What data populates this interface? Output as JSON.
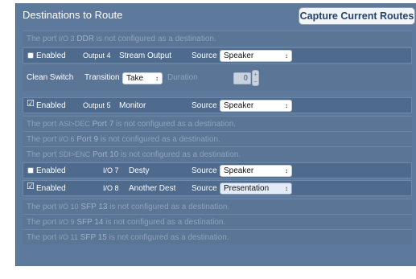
{
  "header": {
    "title": "Destinations to Route",
    "capture_label": "Capture Current Routes"
  },
  "rows": [
    {
      "type": "empty",
      "pre": "The port",
      "port": "I/O 3",
      "name": "DDR",
      "post": "is not configured as a destination."
    },
    {
      "type": "dest",
      "enabled_checked": false,
      "enabled_label": "Enabled",
      "port": "Output 4",
      "name": "Stream Output",
      "source_label": "Source",
      "source_value": "Speaker"
    },
    {
      "type": "clean",
      "clean_label": "Clean Switch",
      "transition_label": "Transition",
      "transition_value": "Take",
      "duration_label": "Duration",
      "duration_value": "0"
    },
    {
      "type": "dest",
      "enabled_checked": true,
      "enabled_label": "Enabled",
      "port": "Output 5",
      "name": "Monitor",
      "source_label": "Source",
      "source_value": "Speaker"
    },
    {
      "type": "empty",
      "pre": "The port",
      "port": "ASI>DEC",
      "name": "Port 7",
      "post": "is not configured as a destination."
    },
    {
      "type": "empty",
      "pre": "The port",
      "port": "I/O 6",
      "name": "Port 9",
      "post": "is not configured as a destination."
    },
    {
      "type": "empty",
      "pre": "The port",
      "port": "SDI>ENC",
      "name": "Port 10",
      "post": "is not configured as a destination."
    },
    {
      "type": "dest",
      "enabled_checked": false,
      "enabled_label": "Enabled",
      "port": "I/O 7",
      "name": "Desty",
      "source_label": "Source",
      "source_value": "Speaker"
    },
    {
      "type": "dest",
      "enabled_checked": true,
      "enabled_label": "Enabled",
      "port": "I/O 8",
      "name": "Another Dest",
      "source_label": "Source",
      "source_value": "Presentation"
    },
    {
      "type": "empty",
      "pre": "The port",
      "port": "I/O 10",
      "name": "SFP 13",
      "post": "is not configured as a destination."
    },
    {
      "type": "empty",
      "pre": "The port",
      "port": "I/O 9",
      "name": "SFP 14",
      "post": "is not configured as a destination."
    },
    {
      "type": "empty",
      "pre": "The port",
      "port": "I/O 11",
      "name": "SFP 15",
      "post": "is not configured as a destination."
    }
  ],
  "icons": {
    "select_arrow": "updown-arrow-icon",
    "checkmark": "checkmark-icon"
  }
}
